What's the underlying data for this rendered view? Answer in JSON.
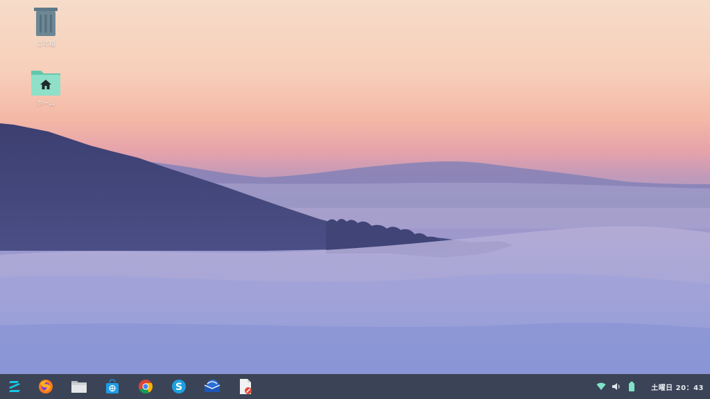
{
  "desktop": {
    "icons": [
      {
        "label": "ゴミ箱",
        "icon": "trash-icon"
      },
      {
        "label": "ホーム",
        "icon": "home-folder-icon"
      }
    ]
  },
  "taskbar": {
    "launchers": [
      {
        "name": "zorin-menu",
        "icon": "zorin-logo-icon"
      },
      {
        "name": "firefox",
        "icon": "firefox-icon"
      },
      {
        "name": "files",
        "icon": "folder-icon"
      },
      {
        "name": "software",
        "icon": "software-store-icon"
      },
      {
        "name": "chrome",
        "icon": "chrome-icon"
      },
      {
        "name": "skype",
        "icon": "skype-icon"
      },
      {
        "name": "mail",
        "icon": "mail-icon"
      },
      {
        "name": "text-editor",
        "icon": "document-icon"
      }
    ],
    "tray": {
      "icons": [
        "wifi-icon",
        "volume-icon",
        "battery-icon"
      ],
      "clock": "土曜日 20：43"
    },
    "colors": {
      "background": "#3b4456",
      "text": "#e8ecf2"
    }
  }
}
